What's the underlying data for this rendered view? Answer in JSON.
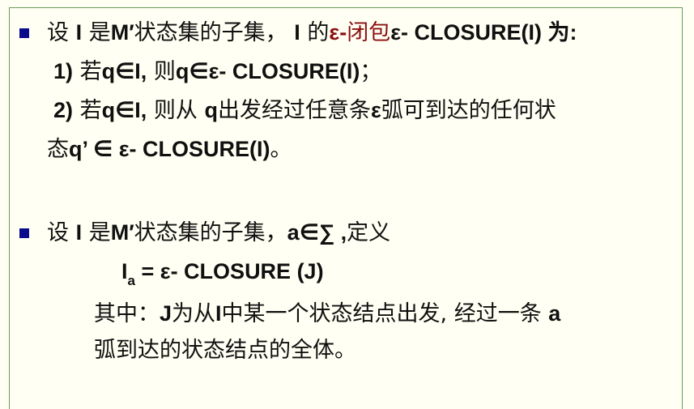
{
  "p1": {
    "pre": "设 ",
    "I1": "I",
    "mid1": " 是",
    "M": "M′",
    "mid2": "状态集的子集，  ",
    "I2": "I",
    "mid3": " 的",
    "eps_red": "ε-",
    "closure_cn": "闭包",
    "closure_expr": "ε- CLOSURE(I)",
    "end": " 为:"
  },
  "p1_item1": {
    "num": "1)",
    "ruo": " 若",
    "cond": "q∈I,",
    "ze": " 则",
    "res": "q∈ε- CLOSURE(I)",
    "end": "；"
  },
  "p1_item2": {
    "num": "2)",
    "ruo": "  若",
    "cond": "q∈I,",
    "ze": " 则从 ",
    "q": "q",
    "rest1": "出发经过任意条",
    "eps": "ε",
    "rest2": "弧可到达的任何状"
  },
  "p1_item2b": {
    "tai": "态",
    "res": "q’ ∈ ε- CLOSURE(I)",
    "end": "。"
  },
  "p2": {
    "pre": "设 ",
    "I1": "I",
    "mid1": " 是",
    "M": "M′",
    "mid2": "状态集的子集，",
    "cond": "a∈∑ ,",
    "end": "定义"
  },
  "formula": {
    "I": "I",
    "sub": "a",
    "rest": " = ε- CLOSURE (J)"
  },
  "desc1": {
    "pre": "其中：",
    "J": "J",
    "mid1": "为从",
    "I": "I",
    "mid2": "中某一个状态结点出发, 经过一条 ",
    "a": "a"
  },
  "desc2": {
    "text": "弧到达的状态结点的全体。"
  },
  "colors": {
    "bullet": "#0a0a8c",
    "highlight": "#8b1010",
    "frame": "#6a9a5a"
  }
}
